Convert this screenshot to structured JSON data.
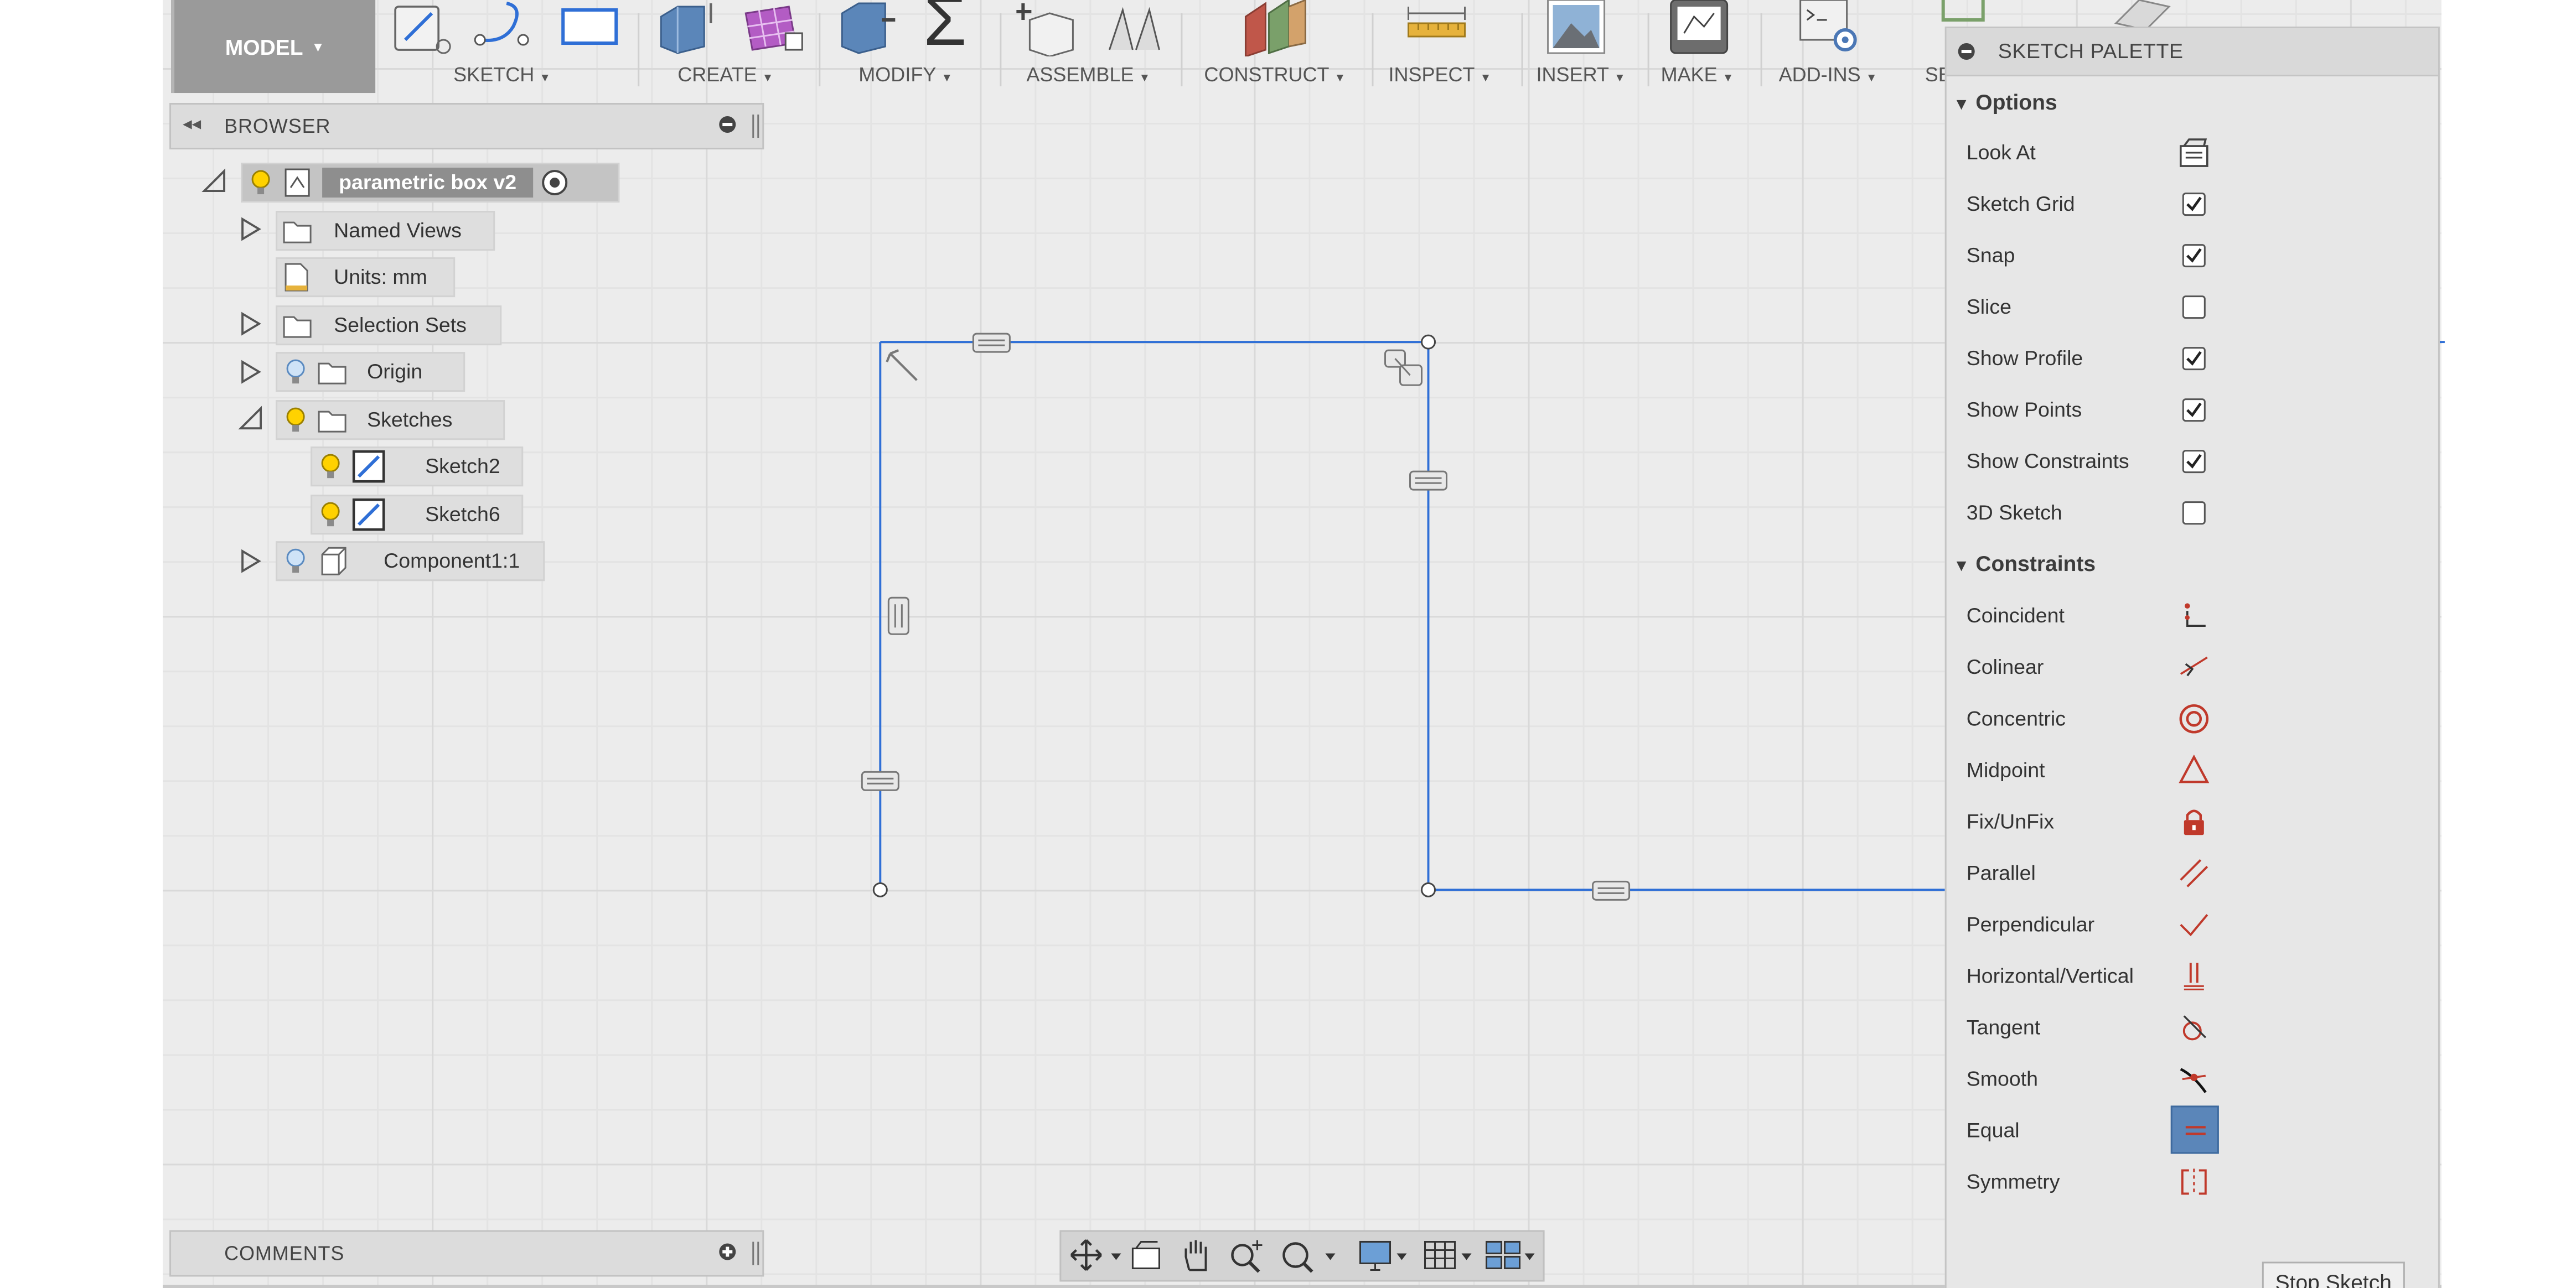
{
  "toolbar": {
    "workspace": "MODEL",
    "groups": [
      {
        "label": "SKETCH"
      },
      {
        "label": "CREATE"
      },
      {
        "label": "MODIFY"
      },
      {
        "label": "ASSEMBLE"
      },
      {
        "label": "CONSTRUCT"
      },
      {
        "label": "INSPECT"
      },
      {
        "label": "INSERT"
      },
      {
        "label": "MAKE"
      },
      {
        "label": "ADD-INS"
      },
      {
        "label": "SE"
      }
    ],
    "modify_sum_glyph": "Σ"
  },
  "browser": {
    "title": "BROWSER",
    "root": "parametric box v2",
    "items": [
      {
        "label": "Named Views"
      },
      {
        "label": "Units: mm"
      },
      {
        "label": "Selection Sets"
      },
      {
        "label": "Origin"
      },
      {
        "label": "Sketches"
      },
      {
        "label": "Sketch2"
      },
      {
        "label": "Sketch6"
      },
      {
        "label": "Component1:1"
      }
    ]
  },
  "comments": {
    "title": "COMMENTS"
  },
  "palette": {
    "title": "SKETCH PALETTE",
    "options_header": "Options",
    "options": [
      {
        "label": "Look At",
        "control": "look-at-icon"
      },
      {
        "label": "Sketch Grid",
        "checked": true
      },
      {
        "label": "Snap",
        "checked": true
      },
      {
        "label": "Slice",
        "checked": false
      },
      {
        "label": "Show Profile",
        "checked": true
      },
      {
        "label": "Show Points",
        "checked": true
      },
      {
        "label": "Show Constraints",
        "checked": true
      },
      {
        "label": "3D Sketch",
        "checked": false
      }
    ],
    "constraints_header": "Constraints",
    "constraints": [
      {
        "label": "Coincident",
        "icon": "coincident-icon"
      },
      {
        "label": "Colinear",
        "icon": "colinear-icon"
      },
      {
        "label": "Concentric",
        "icon": "concentric-icon"
      },
      {
        "label": "Midpoint",
        "icon": "midpoint-icon"
      },
      {
        "label": "Fix/UnFix",
        "icon": "fix-unfix-icon"
      },
      {
        "label": "Parallel",
        "icon": "parallel-icon"
      },
      {
        "label": "Perpendicular",
        "icon": "perpendicular-icon"
      },
      {
        "label": "Horizontal/Vertical",
        "icon": "horizontal-vertical-icon"
      },
      {
        "label": "Tangent",
        "icon": "tangent-icon"
      },
      {
        "label": "Smooth",
        "icon": "smooth-icon"
      },
      {
        "label": "Equal",
        "icon": "equal-icon",
        "active": true
      },
      {
        "label": "Symmetry",
        "icon": "symmetry-icon"
      }
    ],
    "stop_button": "Stop Sketch"
  },
  "colors": {
    "sketch_line": "#2f6fd6",
    "constraint_red": "#c0392b",
    "active_constraint_bg": "#5b86b9",
    "palette_bg": "#e7e7e7"
  }
}
